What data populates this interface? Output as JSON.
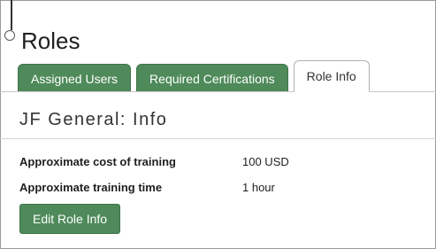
{
  "header": {
    "title": "Roles"
  },
  "tabs": [
    {
      "label": "Assigned Users",
      "active": false
    },
    {
      "label": "Required Certifications",
      "active": false
    },
    {
      "label": "Role Info",
      "active": true
    }
  ],
  "section": {
    "title": "JF General: Info"
  },
  "info": {
    "rows": [
      {
        "label": "Approximate cost of training",
        "value": "100 USD"
      },
      {
        "label": "Approximate training time",
        "value": "1 hour"
      }
    ]
  },
  "actions": {
    "edit_label": "Edit Role Info"
  },
  "colors": {
    "accent_green": "#4e8a5a"
  },
  "icons": {
    "timeline": "timeline-node-icon"
  }
}
